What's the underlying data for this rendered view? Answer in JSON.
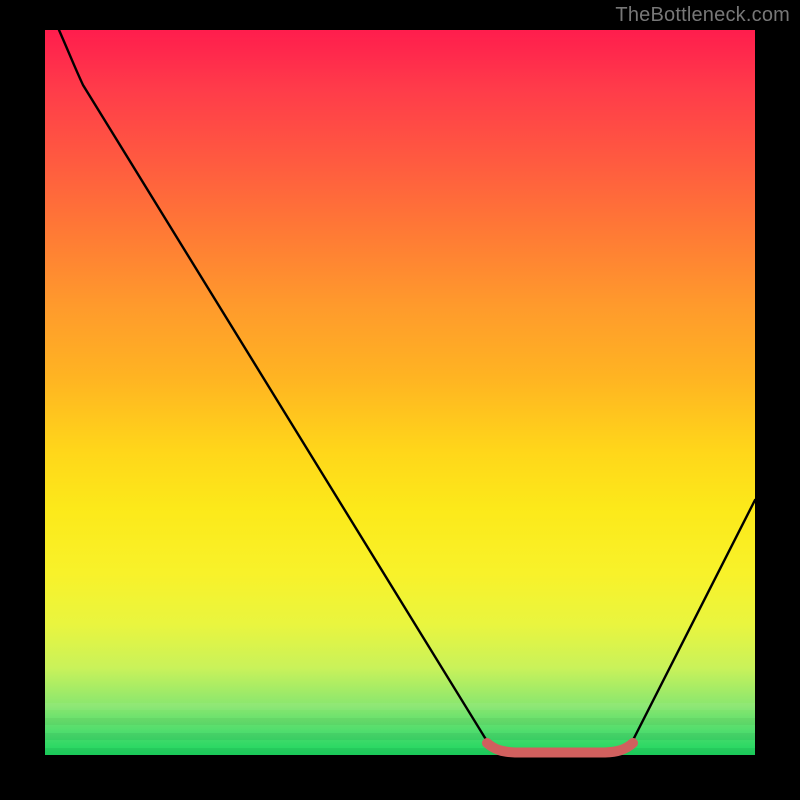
{
  "watermark": "TheBottleneck.com",
  "chart_data": {
    "type": "line",
    "title": "",
    "xlabel": "",
    "ylabel": "",
    "xlim": [
      0,
      100
    ],
    "ylim": [
      0,
      100
    ],
    "series": [
      {
        "name": "bottleneck-curve",
        "x": [
          2,
          5,
          62,
          70,
          78,
          82,
          100
        ],
        "y": [
          100,
          95,
          1,
          0,
          0,
          1,
          35
        ],
        "color": "#000000"
      },
      {
        "name": "optimal-range-marker",
        "x": [
          62,
          65,
          70,
          75,
          79,
          82
        ],
        "y": [
          1.2,
          0.4,
          0.2,
          0.2,
          0.4,
          1.2
        ],
        "color": "#d1605e"
      }
    ],
    "gradient_stops": [
      {
        "pos": 0,
        "color": "#ff1d4d"
      },
      {
        "pos": 50,
        "color": "#ffd61a"
      },
      {
        "pos": 80,
        "color": "#f8f22a"
      },
      {
        "pos": 100,
        "color": "#1bd65f"
      }
    ]
  }
}
